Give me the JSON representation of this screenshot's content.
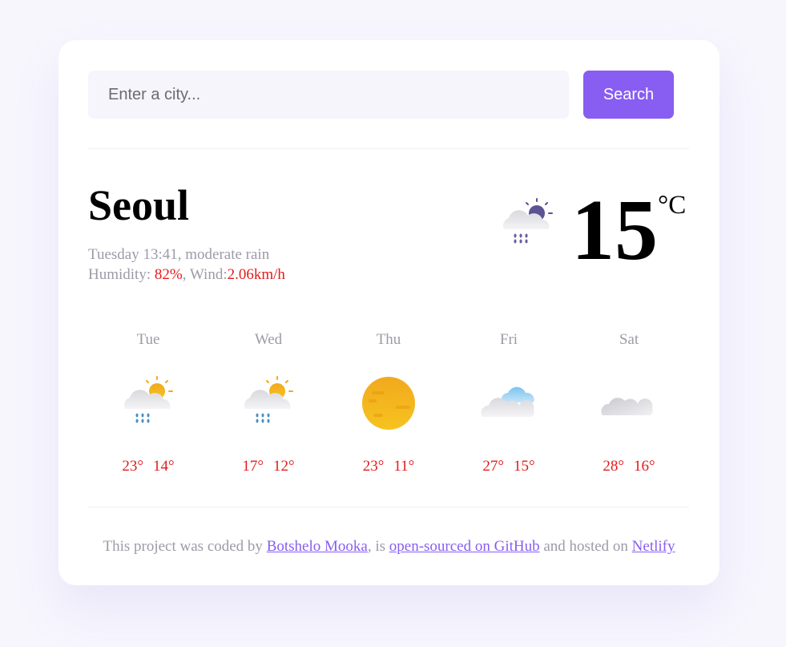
{
  "search": {
    "placeholder": "Enter a city...",
    "button_label": "Search"
  },
  "current": {
    "city": "Seoul",
    "datetime": "Tuesday 13:41",
    "description": "moderate rain",
    "humidity_label": "Humidity: ",
    "humidity_value": "82%",
    "wind_label": "Wind:",
    "wind_value": "2.06km/h",
    "temperature": "15",
    "unit": "°C",
    "icon": "rain-partly-sunny-icon"
  },
  "forecast": [
    {
      "day": "Tue",
      "max": "23°",
      "min": "14°",
      "icon": "rain-partly-sunny-icon"
    },
    {
      "day": "Wed",
      "max": "17°",
      "min": "12°",
      "icon": "rain-partly-sunny-icon"
    },
    {
      "day": "Thu",
      "max": "23°",
      "min": "11°",
      "icon": "sun-icon"
    },
    {
      "day": "Fri",
      "max": "27°",
      "min": "15°",
      "icon": "partly-cloudy-icon"
    },
    {
      "day": "Sat",
      "max": "28°",
      "min": "16°",
      "icon": "cloud-icon"
    }
  ],
  "footer": {
    "prefix": "This project was coded by ",
    "author_link": "Botshelo Mooka",
    "middle": ", is ",
    "github_link": "open-sourced on GitHub",
    "suffix": " and hosted on ",
    "netlify_link": "Netlify"
  },
  "colors": {
    "accent": "#885df1",
    "highlight": "#e41b1b",
    "muted_text": "#9e9aa8",
    "background": "#f7f6fd"
  }
}
